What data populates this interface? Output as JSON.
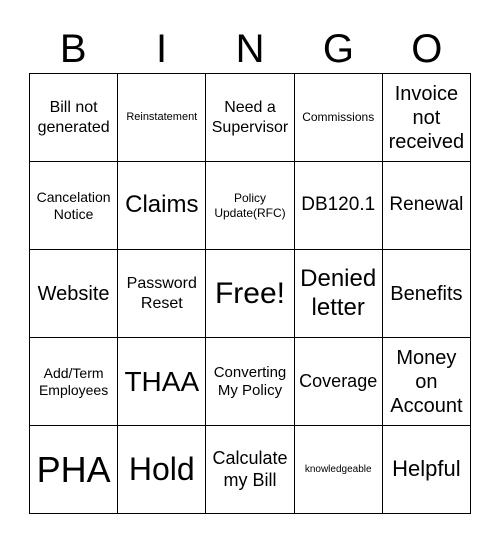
{
  "header": [
    "B",
    "I",
    "N",
    "G",
    "O"
  ],
  "cells": [
    "Bill not generated",
    "Reinstatement",
    "Need a Supervisor",
    "Commissions",
    "Invoice not received",
    "Cancelation Notice",
    "Claims",
    "Policy Update(RFC)",
    "DB120.1",
    "Renewal",
    "Website",
    "Password Reset",
    "Free!",
    "Denied letter",
    "Benefits",
    "Add/Term Employees",
    "THAA",
    "Converting My Policy",
    "Coverage",
    "Money on Account",
    "PHA",
    "Hold",
    "Calculate my Bill",
    "knowledgeable",
    "Helpful"
  ]
}
